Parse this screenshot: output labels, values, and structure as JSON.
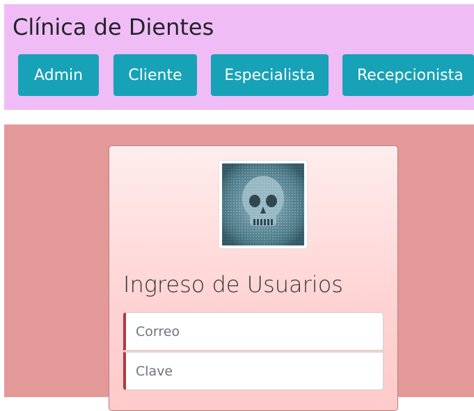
{
  "header": {
    "brand": "Clínica de Dientes",
    "nav": [
      {
        "label": "Admin"
      },
      {
        "label": "Cliente"
      },
      {
        "label": "Especialista"
      },
      {
        "label": "Recepcionista"
      }
    ]
  },
  "login": {
    "avatar_icon": "skull-avatar-image",
    "title": "Ingreso de Usuarios",
    "email_placeholder": "Correo",
    "email_value": "",
    "password_placeholder": "Clave",
    "password_value": ""
  },
  "colors": {
    "header_bg": "#f0bcf6",
    "nav_button": "#17a2b8",
    "content_bg": "#e49999",
    "field_accent": "#b23a3a"
  }
}
